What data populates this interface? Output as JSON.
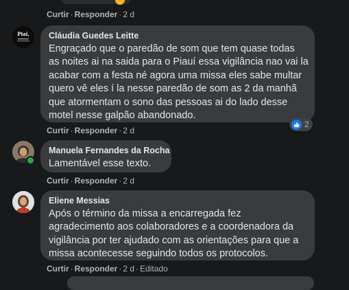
{
  "ui": {
    "like_label": "Curtir",
    "reply_label": "Responder",
    "separator": "·",
    "edited_label": "Editado",
    "top_time": "2 d"
  },
  "comments": [
    {
      "author": "Cláudia Guedes Leitte",
      "avatar_text": "Piaí,",
      "lines": [
        "Engraçado que o paredão de som que tem quase todas",
        "as noites ai na saida para o Piauí essa vigilância nao vai la",
        "acabar com a festa né agora uma missa eles sabe multar",
        "quero vê eles í la nesse paredão de som as 2 da manhã",
        "que atormentam o sono das pessoas ai do lado desse",
        "motel nesse galpão abandonado."
      ],
      "time": "2 d",
      "reaction_count": "2"
    },
    {
      "author": "Manuela Fernandes da Rocha",
      "lines": [
        "Lamentável esse texto."
      ],
      "time": "2 d"
    },
    {
      "author": "Eliene Messias",
      "lines": [
        "Após o término da missa a encarregada fez",
        "agradecimento aos colaboradores e a coordenadora da",
        "vigilância por ter ajudado com as orientações para que a",
        "missa acontecesse seguindo todos os protocolos."
      ],
      "time": "2 d"
    }
  ],
  "colors": {
    "background": "#18191a",
    "bubble": "#3a3b3c",
    "text": "#e4e6eb",
    "secondary": "#b0b3b8",
    "like_blue": "#1877f2",
    "online_green": "#31a24c"
  }
}
